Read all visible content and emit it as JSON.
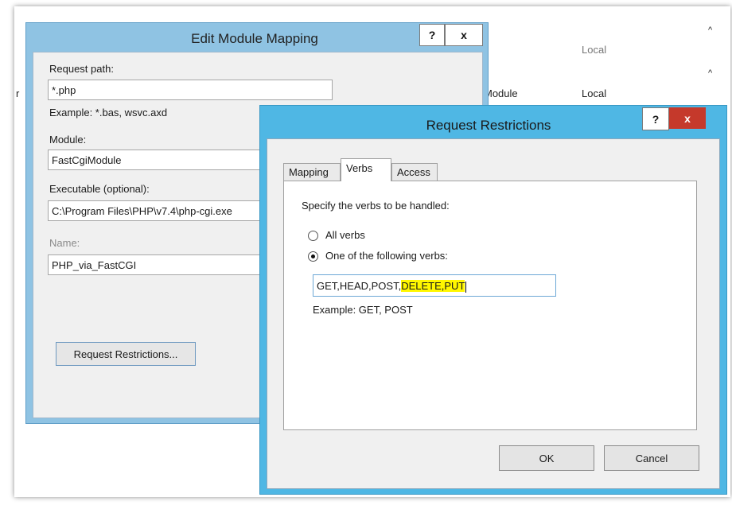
{
  "background_list": {
    "col_local_header": "Local",
    "row_module": "Module",
    "row_local": "Local",
    "row_prefix": "r",
    "scroll_up_1": "^",
    "scroll_up_2": "^"
  },
  "edit_module_mapping": {
    "title": "Edit Module Mapping",
    "help_label": "?",
    "close_label": "x",
    "request_path_label": "Request path:",
    "request_path_value": "*.php",
    "request_path_example": "Example: *.bas, wsvc.axd",
    "module_label": "Module:",
    "module_value": "FastCgiModule",
    "executable_label": "Executable (optional):",
    "executable_value": "C:\\Program Files\\PHP\\v7.4\\php-cgi.exe",
    "name_label": "Name:",
    "name_value": "PHP_via_FastCGI",
    "request_restrictions_button": "Request Restrictions..."
  },
  "request_restrictions": {
    "title": "Request Restrictions",
    "help_label": "?",
    "close_label": "x",
    "tabs": [
      {
        "label": "Mapping",
        "active": false
      },
      {
        "label": "Verbs",
        "active": true
      },
      {
        "label": "Access",
        "active": false
      }
    ],
    "instruction": "Specify the verbs to be handled:",
    "option_all_verbs": "All verbs",
    "option_following_verbs": "One of the following verbs:",
    "selected_option": "One of the following verbs:",
    "verbs_value_plain": "GET,HEAD,POST,",
    "verbs_value_highlighted": "DELETE,PUT",
    "verbs_example": "Example: GET, POST",
    "ok_button": "OK",
    "cancel_button": "Cancel"
  },
  "colors": {
    "dialog1_frame": "#8fc3e3",
    "dialog2_frame": "#4fb7e4",
    "close_button": "#c5392b",
    "highlight": "#fff700"
  }
}
